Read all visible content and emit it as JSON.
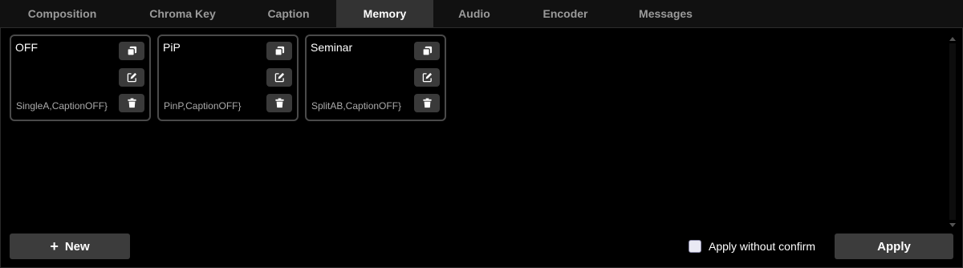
{
  "tabs": [
    {
      "label": "Composition",
      "active": false
    },
    {
      "label": "Chroma Key",
      "active": false
    },
    {
      "label": "Caption",
      "active": false
    },
    {
      "label": "Memory",
      "active": true
    },
    {
      "label": "Audio",
      "active": false
    },
    {
      "label": "Encoder",
      "active": false
    },
    {
      "label": "Messages",
      "active": false
    }
  ],
  "memory": {
    "items": [
      {
        "name": "OFF",
        "description": "SingleA,CaptionOFF}"
      },
      {
        "name": "PiP",
        "description": "PinP,CaptionOFF}"
      },
      {
        "name": "Seminar",
        "description": "SplitAB,CaptionOFF}"
      }
    ],
    "item_icons": [
      "copy-icon",
      "edit-icon",
      "trash-icon"
    ]
  },
  "footer": {
    "new_icon": "+",
    "new_label": "New",
    "apply_without_confirm_label": "Apply without confirm",
    "apply_without_confirm_checked": false,
    "apply_label": "Apply"
  },
  "colors": {
    "background": "#000000",
    "tab_bar": "#111111",
    "active_tab": "#333333",
    "button": "#3c3c3c",
    "card_border": "#4a4a4a"
  }
}
